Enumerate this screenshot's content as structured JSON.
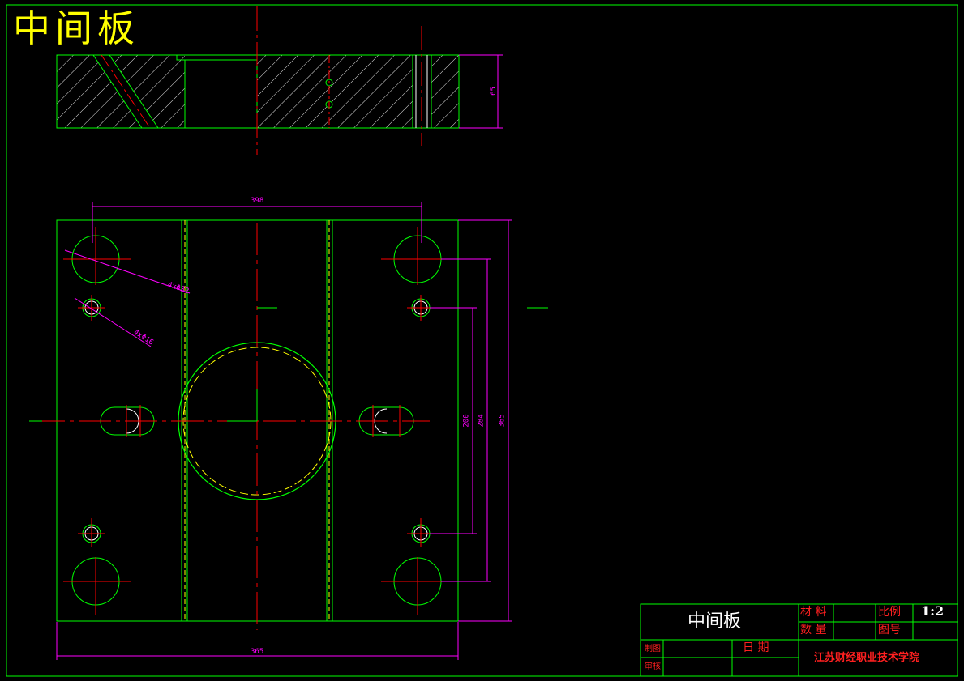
{
  "drawing_title": "中间板",
  "dimensions": {
    "top_height": "65",
    "top_width": "398",
    "bottom_width": "365",
    "right_height": "365",
    "pitch_1": "284",
    "pitch_2": "200",
    "diameter_large": "4xΦ32",
    "diameter_small": "4xΦ16"
  },
  "title_block": {
    "part_name": "中间板",
    "material_label": "材 料",
    "quantity_label": "数 量",
    "scale_label": "比例",
    "scale_value": "1:2",
    "drawing_no_label": "图号",
    "drawn_label": "制图",
    "checked_label": "审核",
    "date_label": "日  期",
    "school": "江苏财经职业技术学院"
  },
  "colors": {
    "background": "#000000",
    "outline": "#00ff00",
    "centerline": "#ff0000",
    "dimension": "#ff00ff",
    "hidden": "#ffff00",
    "title_text": "#ffff00"
  }
}
